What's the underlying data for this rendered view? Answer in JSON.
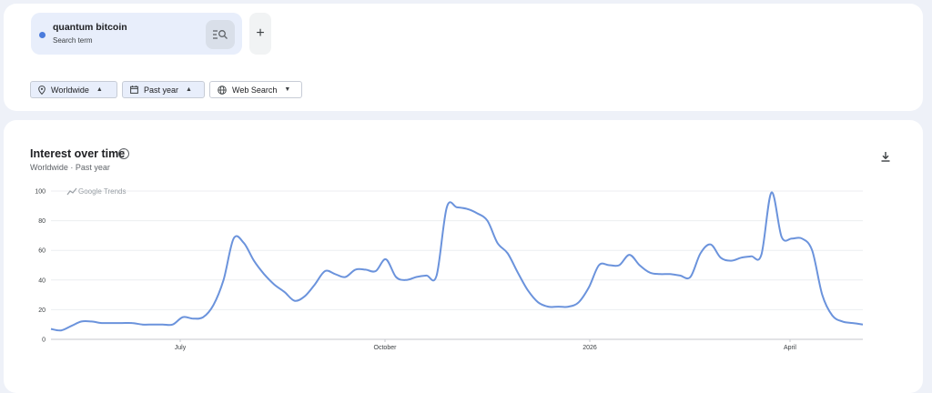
{
  "search_term": {
    "name": "quantum bitcoin",
    "type": "Search term",
    "color": "#4a7bdc",
    "icon": "search-compare-icon"
  },
  "add_button": {
    "label": "+"
  },
  "filters": {
    "region": {
      "label": "Worldwide",
      "icon": "location-pin-icon"
    },
    "time": {
      "label": "Past year",
      "icon": "calendar-icon"
    },
    "property": {
      "label": "Web Search",
      "icon": "globe-icon"
    }
  },
  "chart_section": {
    "title": "Interest over time",
    "subtitle": "Worldwide · Past year",
    "watermark": "Google Trends",
    "download_icon": "download-icon",
    "info_icon": "info-icon",
    "info_glyph": "i"
  },
  "chart_data": {
    "type": "line",
    "ylim": [
      0,
      100
    ],
    "y_ticks": [
      0,
      20,
      40,
      60,
      80,
      100
    ],
    "x_ticks": [
      "July",
      "October",
      "2026",
      "April"
    ],
    "grid": true,
    "line_color": "#6b93dc",
    "series": [
      {
        "values": [
          7,
          6,
          9,
          12,
          12,
          11,
          11,
          11,
          11,
          10,
          10,
          10,
          10,
          15,
          14,
          15,
          23,
          40,
          68,
          65,
          53,
          44,
          37,
          32,
          26,
          29,
          37,
          46,
          44,
          42,
          47,
          47,
          46,
          54,
          42,
          40,
          42,
          43,
          43,
          89,
          89,
          88,
          85,
          80,
          65,
          58,
          45,
          33,
          25,
          22,
          22,
          22,
          25,
          35,
          50,
          50,
          50,
          57,
          50,
          45,
          44,
          44,
          43,
          42,
          58,
          64,
          55,
          53,
          55,
          56,
          57,
          99,
          69,
          68,
          68,
          60,
          30,
          16,
          12,
          11,
          10
        ]
      }
    ]
  }
}
